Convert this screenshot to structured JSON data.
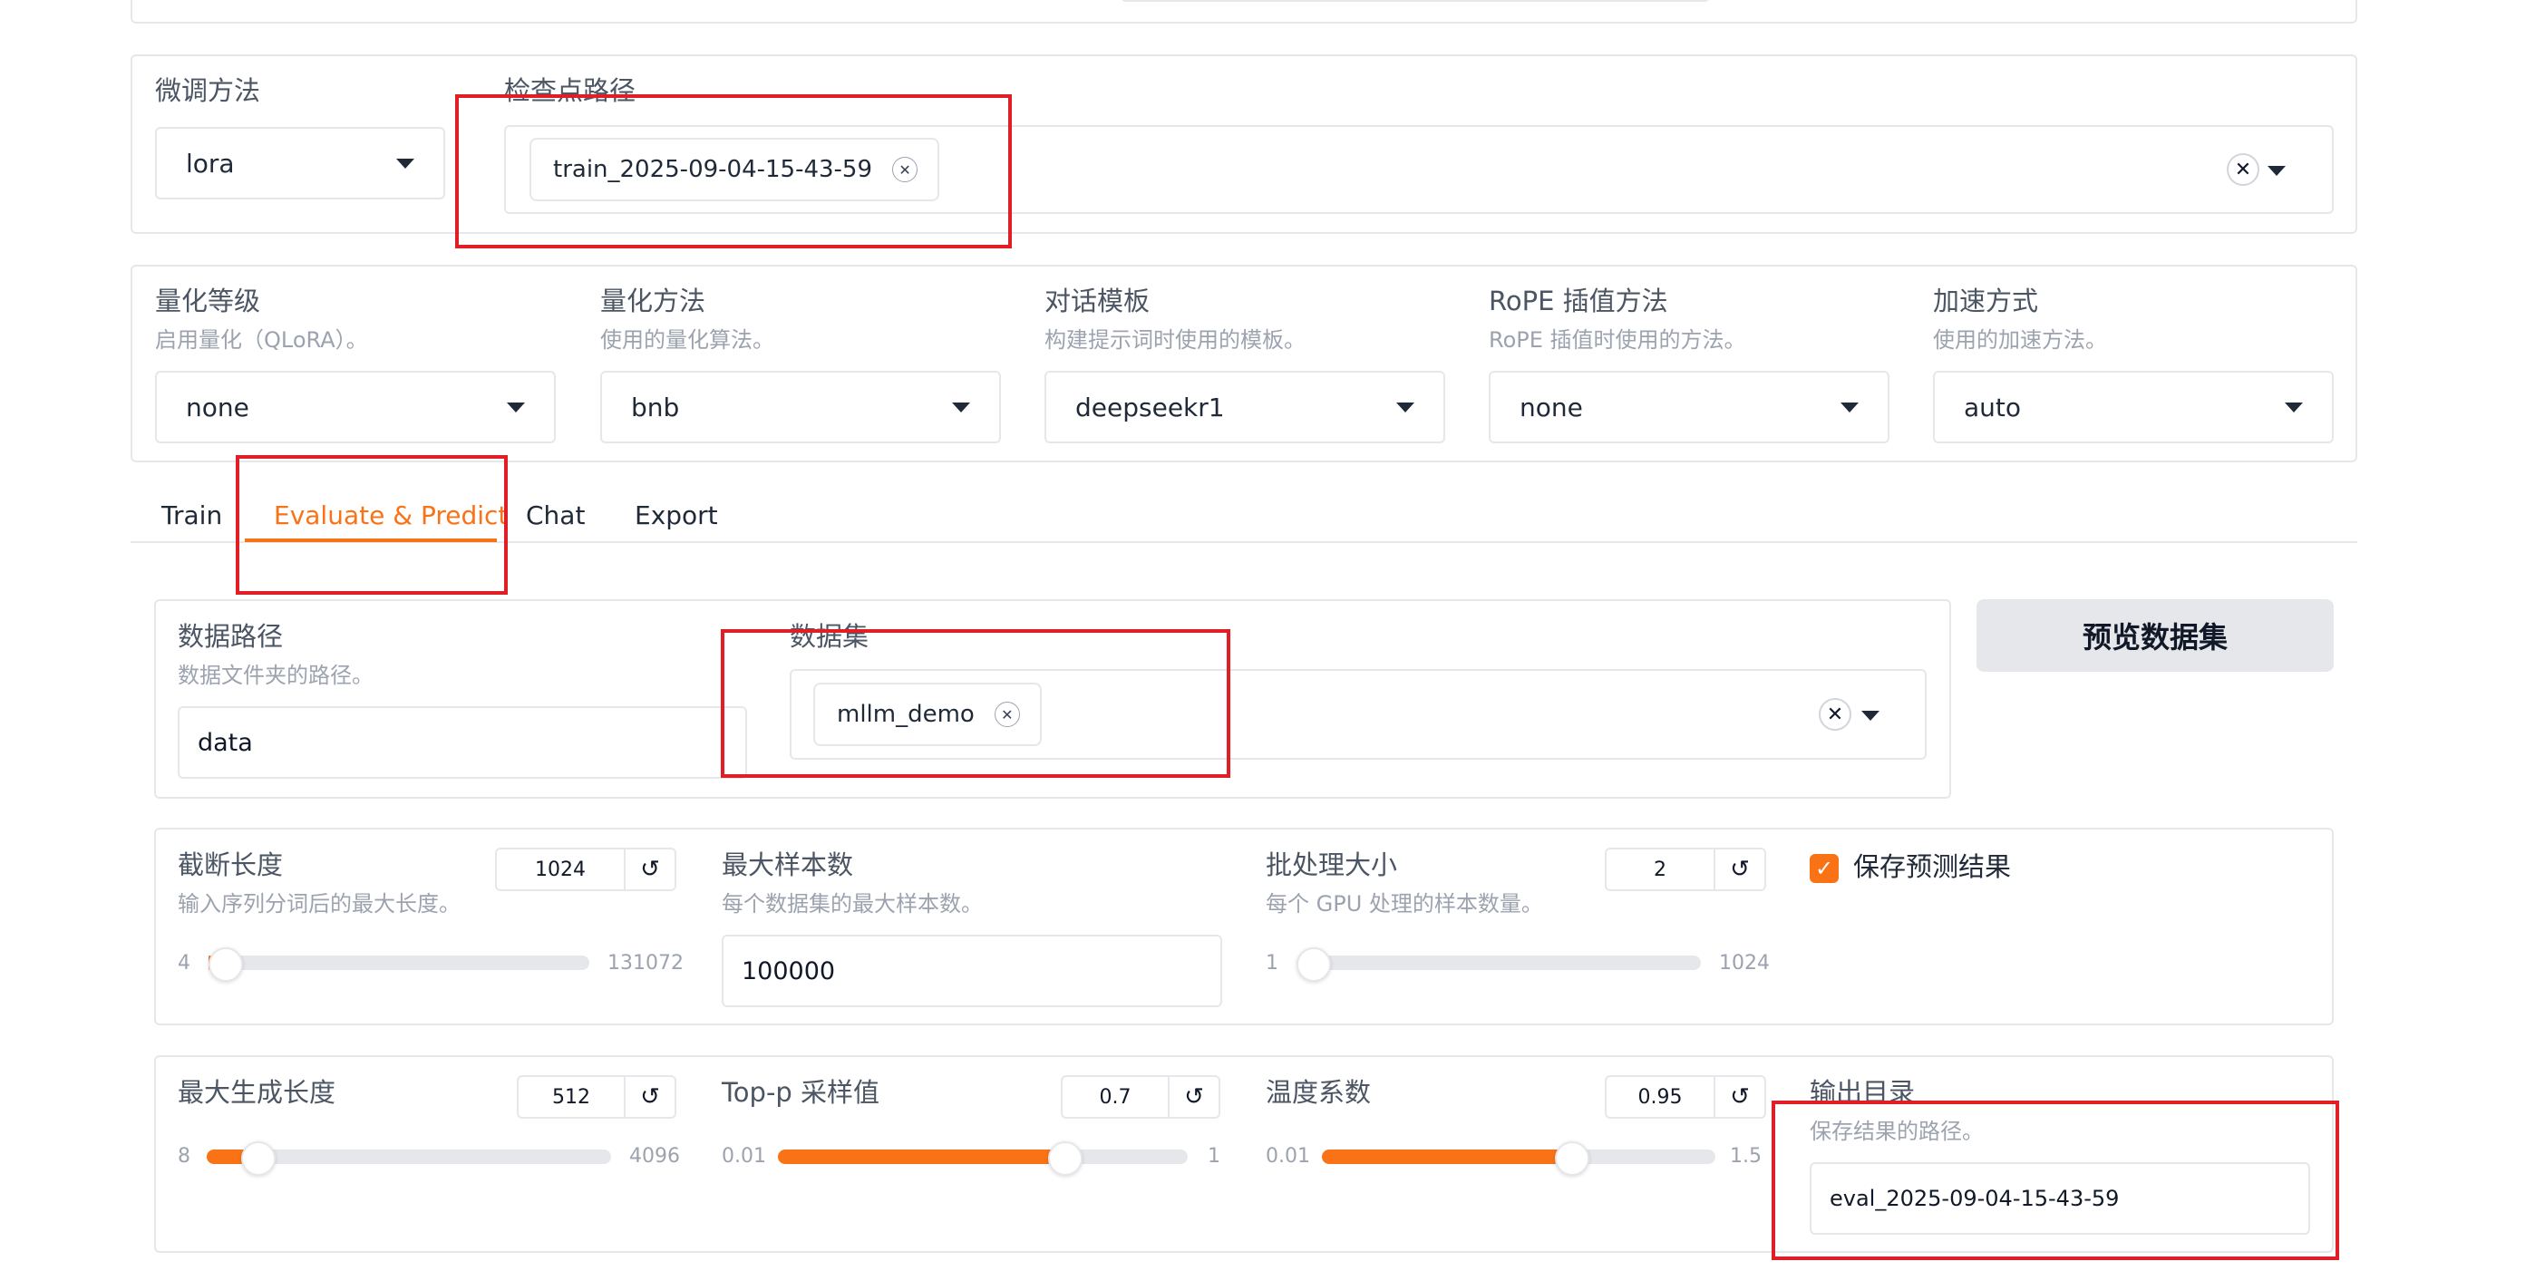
{
  "model": {
    "finetune_label": "微调方法",
    "finetune_value": "lora",
    "checkpoint_label": "检查点路径",
    "checkpoint_token": "train_2025-09-04-15-43-59"
  },
  "quant": {
    "level_label": "量化等级",
    "level_info": "启用量化（QLoRA）。",
    "level_value": "none",
    "method_label": "量化方法",
    "method_info": "使用的量化算法。",
    "method_value": "bnb",
    "template_label": "对话模板",
    "template_info": "构建提示词时使用的模板。",
    "template_value": "deepseekr1",
    "rope_label": "RoPE 插值方法",
    "rope_info": "RoPE 插值时使用的方法。",
    "rope_value": "none",
    "accel_label": "加速方式",
    "accel_info": "使用的加速方法。",
    "accel_value": "auto"
  },
  "tabs": [
    "Train",
    "Evaluate & Predict",
    "Chat",
    "Export"
  ],
  "active_tab": "Evaluate & Predict",
  "dataset": {
    "dir_label": "数据路径",
    "dir_info": "数据文件夹的路径。",
    "dir_value": "data",
    "ds_label": "数据集",
    "ds_token": "mllm_demo",
    "preview_button": "预览数据集"
  },
  "eval": {
    "cutoff": {
      "label": "截断长度",
      "info": "输入序列分词后的最大长度。",
      "value": "1024",
      "min": "4",
      "max": "131072",
      "fraction": 0.008
    },
    "max_samples": {
      "label": "最大样本数",
      "info": "每个数据集的最大样本数。",
      "value": "100000"
    },
    "batch": {
      "label": "批处理大小",
      "info": "每个 GPU 处理的样本数量。",
      "value": "2",
      "min": "1",
      "max": "1024",
      "fraction": 0.001
    },
    "save_predict": {
      "label": "保存预测结果",
      "checked": true
    },
    "max_new_tokens": {
      "label": "最大生成长度",
      "value": "512",
      "min": "8",
      "max": "4096",
      "fraction": 0.123
    },
    "top_p": {
      "label": "Top-p 采样值",
      "value": "0.7",
      "min": "0.01",
      "max": "1",
      "fraction": 0.697
    },
    "temperature": {
      "label": "温度系数",
      "value": "0.95",
      "min": "0.01",
      "max": "1.5",
      "fraction": 0.631
    },
    "output_dir": {
      "label": "输出目录",
      "info": "保存结果的路径。",
      "value": "eval_2025-09-04-15-43-59"
    }
  },
  "colors": {
    "accent": "#f97316",
    "highlight": "#e11d26",
    "border": "#e5e7eb"
  }
}
